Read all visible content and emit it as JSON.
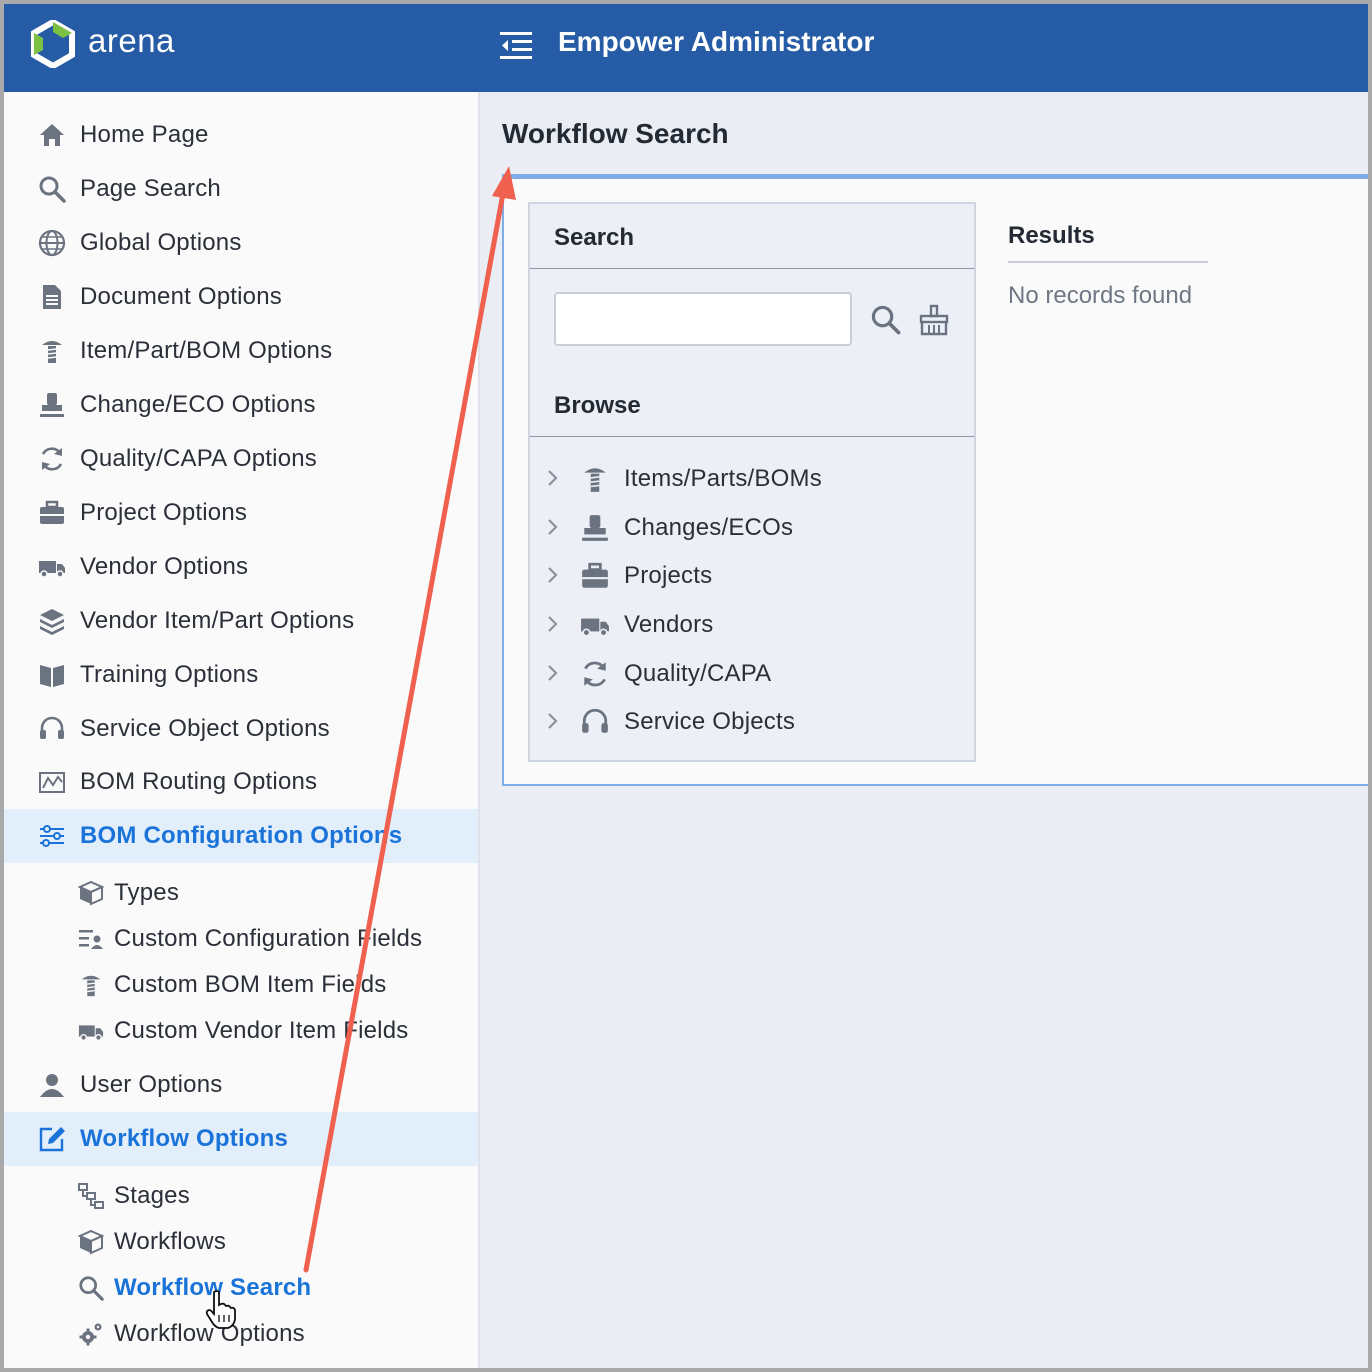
{
  "header": {
    "logo_text": "arena",
    "app_title": "Empower Administrator",
    "brand_color": "#265ca6"
  },
  "sidebar": {
    "items": [
      {
        "label": "Home Page",
        "icon": "home-icon"
      },
      {
        "label": "Page Search",
        "icon": "search-icon"
      },
      {
        "label": "Global Options",
        "icon": "globe-icon"
      },
      {
        "label": "Document Options",
        "icon": "document-icon"
      },
      {
        "label": "Item/Part/BOM Options",
        "icon": "screw-icon"
      },
      {
        "label": "Change/ECO Options",
        "icon": "stamp-icon"
      },
      {
        "label": "Quality/CAPA Options",
        "icon": "refresh-icon"
      },
      {
        "label": "Project Options",
        "icon": "briefcase-icon"
      },
      {
        "label": "Vendor Options",
        "icon": "truck-icon"
      },
      {
        "label": "Vendor Item/Part Options",
        "icon": "boxes-icon"
      },
      {
        "label": "Training Options",
        "icon": "book-icon"
      },
      {
        "label": "Service Object Options",
        "icon": "headset-icon"
      },
      {
        "label": "BOM Routing Options",
        "icon": "map-icon"
      },
      {
        "label": "BOM Configuration Options",
        "icon": "sliders-icon",
        "active": true
      },
      {
        "label": "User Options",
        "icon": "user-icon"
      },
      {
        "label": "Workflow Options",
        "icon": "edit-icon",
        "active": true
      }
    ],
    "bom_config_sub": [
      {
        "label": "Types",
        "icon": "cube-icon"
      },
      {
        "label": "Custom Configuration Fields",
        "icon": "form-user-icon"
      },
      {
        "label": "Custom BOM Item Fields",
        "icon": "screw-icon"
      },
      {
        "label": "Custom Vendor Item Fields",
        "icon": "truck-icon"
      }
    ],
    "workflow_sub": [
      {
        "label": "Stages",
        "icon": "hierarchy-icon"
      },
      {
        "label": "Workflows",
        "icon": "cube-icon"
      },
      {
        "label": "Workflow Search",
        "icon": "search-icon",
        "current": true
      },
      {
        "label": "Workflow Options",
        "icon": "gears-icon"
      }
    ],
    "active_color": "#1a73d9"
  },
  "main": {
    "title": "Workflow Search",
    "search": {
      "heading": "Search",
      "value": "",
      "placeholder": ""
    },
    "browse": {
      "heading": "Browse",
      "items": [
        {
          "label": "Items/Parts/BOMs",
          "icon": "screw-icon"
        },
        {
          "label": "Changes/ECOs",
          "icon": "stamp-icon"
        },
        {
          "label": "Projects",
          "icon": "briefcase-icon"
        },
        {
          "label": "Vendors",
          "icon": "truck-icon"
        },
        {
          "label": "Quality/CAPA",
          "icon": "refresh-icon"
        },
        {
          "label": "Service Objects",
          "icon": "headset-icon"
        }
      ]
    },
    "results": {
      "heading": "Results",
      "empty_text": "No records found"
    }
  },
  "annotation_color": "#f0604f"
}
